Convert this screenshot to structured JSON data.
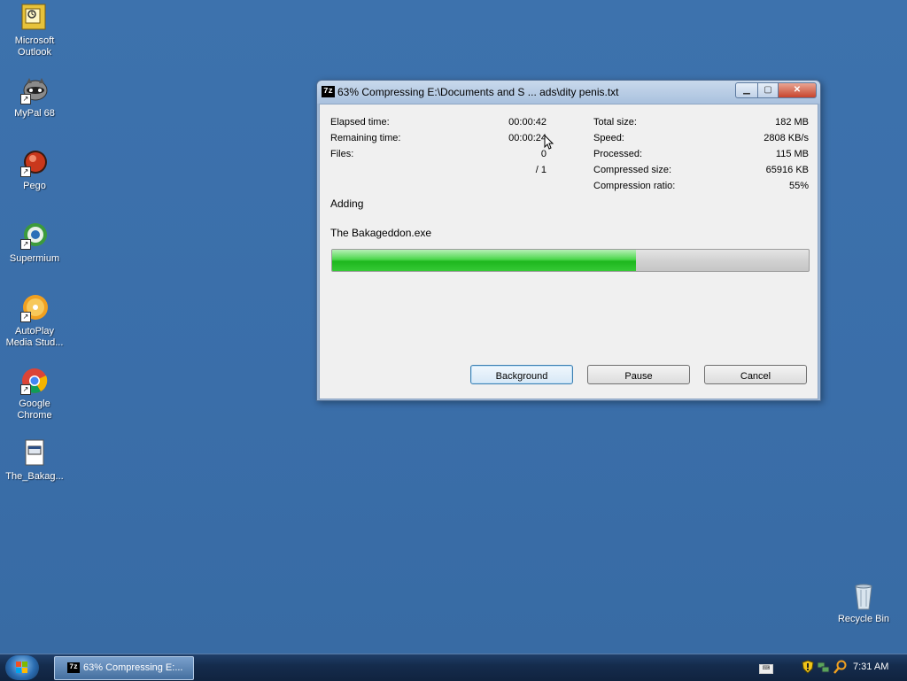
{
  "desktop": {
    "icons": [
      {
        "label_line1": "Microsoft",
        "label_line2": "Outlook"
      },
      {
        "label_line1": "MyPal 68",
        "label_line2": ""
      },
      {
        "label_line1": "Pego",
        "label_line2": ""
      },
      {
        "label_line1": "Supermium",
        "label_line2": ""
      },
      {
        "label_line1": "AutoPlay",
        "label_line2": "Media Stud..."
      },
      {
        "label_line1": "Google",
        "label_line2": "Chrome"
      },
      {
        "label_line1": "The_Bakag...",
        "label_line2": ""
      },
      {
        "label_line1": "Recycle Bin",
        "label_line2": ""
      }
    ]
  },
  "window": {
    "title": "63% Compressing E:\\Documents and S ... ads\\dity penis.txt",
    "icon_text": "7z",
    "stats_left": [
      {
        "label": "Elapsed time:",
        "value": "00:00:42"
      },
      {
        "label": "Remaining time:",
        "value": "00:00:24"
      },
      {
        "label": "Files:",
        "value": "0"
      },
      {
        "label": "",
        "value": "/ 1"
      }
    ],
    "stats_right": [
      {
        "label": "Total size:",
        "value": "182 MB"
      },
      {
        "label": "Speed:",
        "value": "2808 KB/s"
      },
      {
        "label": "Processed:",
        "value": "115 MB"
      },
      {
        "label": "Compressed size:",
        "value": "65916 KB"
      },
      {
        "label": "Compression ratio:",
        "value": "55%"
      }
    ],
    "status": "Adding",
    "current_file": "The Bakageddon.exe",
    "progress_fraction": 0.637,
    "buttons": {
      "background": "Background",
      "pause": "Pause",
      "cancel": "Cancel"
    }
  },
  "taskbar": {
    "item_label": "63% Compressing E:...",
    "item_icon_text": "7z",
    "clock": "7:31 AM"
  }
}
